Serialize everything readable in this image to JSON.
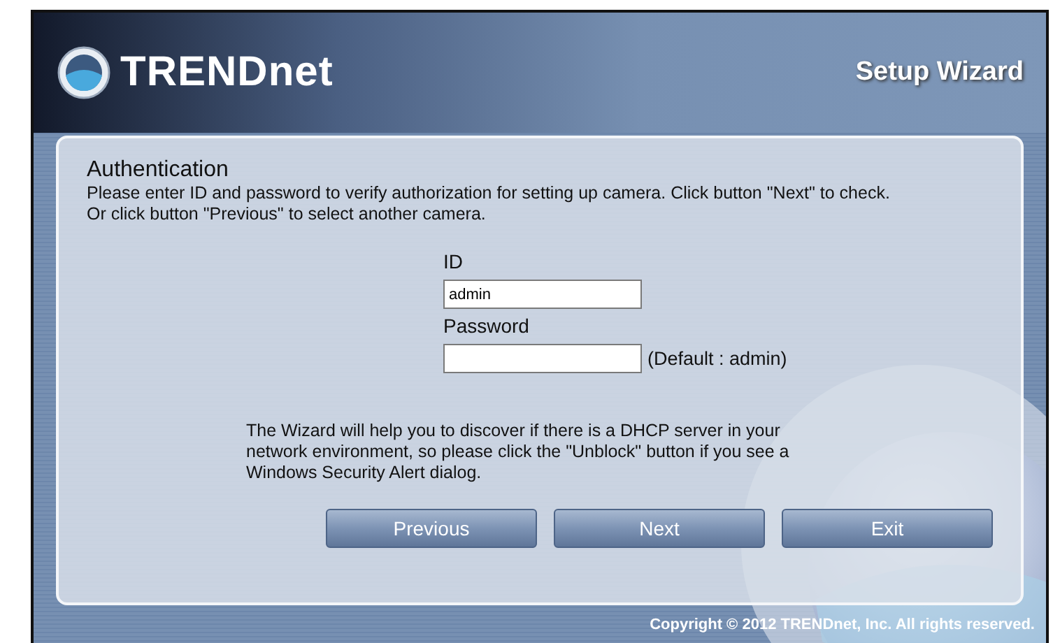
{
  "header": {
    "brand": "TRENDnet",
    "title": "Setup Wizard"
  },
  "panel": {
    "heading": "Authentication",
    "instructions": [
      "Please enter ID and password to verify authorization for setting up camera. Click button \"Next\" to check.",
      "Or click button \"Previous\" to select another camera."
    ],
    "fields": [
      {
        "label": "ID",
        "value": "admin"
      },
      {
        "label": "Password",
        "hint": "(Default : admin)"
      }
    ],
    "note": "The Wizard will help you to discover if there is a DHCP server in your network environment, so please click the \"Unblock\" button if you see a Windows Security Alert dialog.",
    "buttons": [
      "Previous",
      "Next",
      "Exit"
    ]
  },
  "footer": {
    "copyright": "Copyright © 2012 TRENDnet, Inc. All rights reserved."
  }
}
